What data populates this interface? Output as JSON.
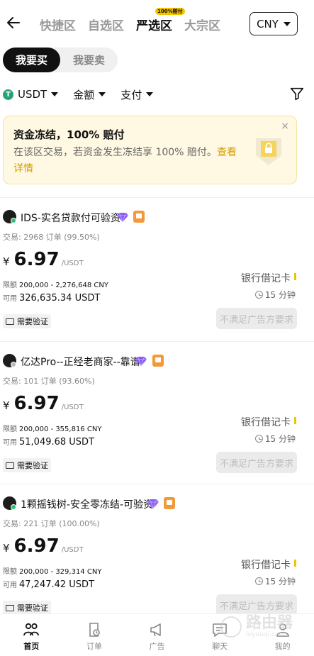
{
  "header": {
    "tabs": [
      {
        "label": "快捷区",
        "active": false
      },
      {
        "label": "自选区",
        "active": false
      },
      {
        "label": "严选区",
        "active": true,
        "badge": "100%赔付"
      },
      {
        "label": "大宗区",
        "active": false
      }
    ],
    "currency": "CNY"
  },
  "segment": {
    "buy": "我要买",
    "sell": "我要卖"
  },
  "filters": {
    "coin": "USDT",
    "coin_icon": "T",
    "amount": "金额",
    "payment": "支付"
  },
  "banner": {
    "title": "资金冻结，100% 赔付",
    "text": "在该区交易，若资金发生冻结享 100% 赔付。",
    "link": "查看详情",
    "close": "×"
  },
  "listings": [
    {
      "merchant": "IDS-实名贷款付可验资",
      "trades": "交易: 2968 订单 (99.50%)",
      "yen": "¥",
      "price": "6.97",
      "unit": "/USDT",
      "limit_label": "限额",
      "limit": "200,000 - 2,276,648 CNY",
      "avail_label": "可用",
      "available": "326,635.34 USDT",
      "payment": "银行借记卡",
      "time": "15 分钟",
      "verify": "需要验证",
      "action": "不满足广告方要求",
      "online": true
    },
    {
      "merchant": "亿达Pro--正经老商家--靠谱",
      "trades": "交易: 101 订单 (93.60%)",
      "yen": "¥",
      "price": "6.97",
      "unit": "/USDT",
      "limit_label": "限额",
      "limit": "200,000 - 355,816 CNY",
      "avail_label": "可用",
      "available": "51,049.68 USDT",
      "payment": "银行借记卡",
      "time": "15 分钟",
      "verify": "需要验证",
      "action": "不满足广告方要求",
      "online": false
    },
    {
      "merchant": "1颗摇钱树-安全零冻结-可验资",
      "trades": "交易: 221 订单 (100.00%)",
      "yen": "¥",
      "price": "6.97",
      "unit": "/USDT",
      "limit_label": "限额",
      "limit": "200,000 - 329,314 CNY",
      "avail_label": "可用",
      "available": "47,247.42 USDT",
      "payment": "银行借记卡",
      "time": "15 分钟",
      "verify": "需要验证",
      "action": "不满足广告方要求",
      "online": true
    }
  ],
  "nav": [
    {
      "label": "首页",
      "icon": "home-people-icon",
      "active": true
    },
    {
      "label": "订单",
      "icon": "order-clock-icon",
      "active": false
    },
    {
      "label": "广告",
      "icon": "megaphone-icon",
      "active": false
    },
    {
      "label": "聊天",
      "icon": "chat-icon",
      "active": false
    },
    {
      "label": "我的",
      "icon": "profile-icon",
      "active": false
    }
  ],
  "watermark": {
    "text": "路由器",
    "sub": "luyouqi.com"
  },
  "colors": {
    "accent": "#f2c200",
    "online": "#2bbf77",
    "tether": "#26a17b",
    "link": "#d29d00"
  }
}
